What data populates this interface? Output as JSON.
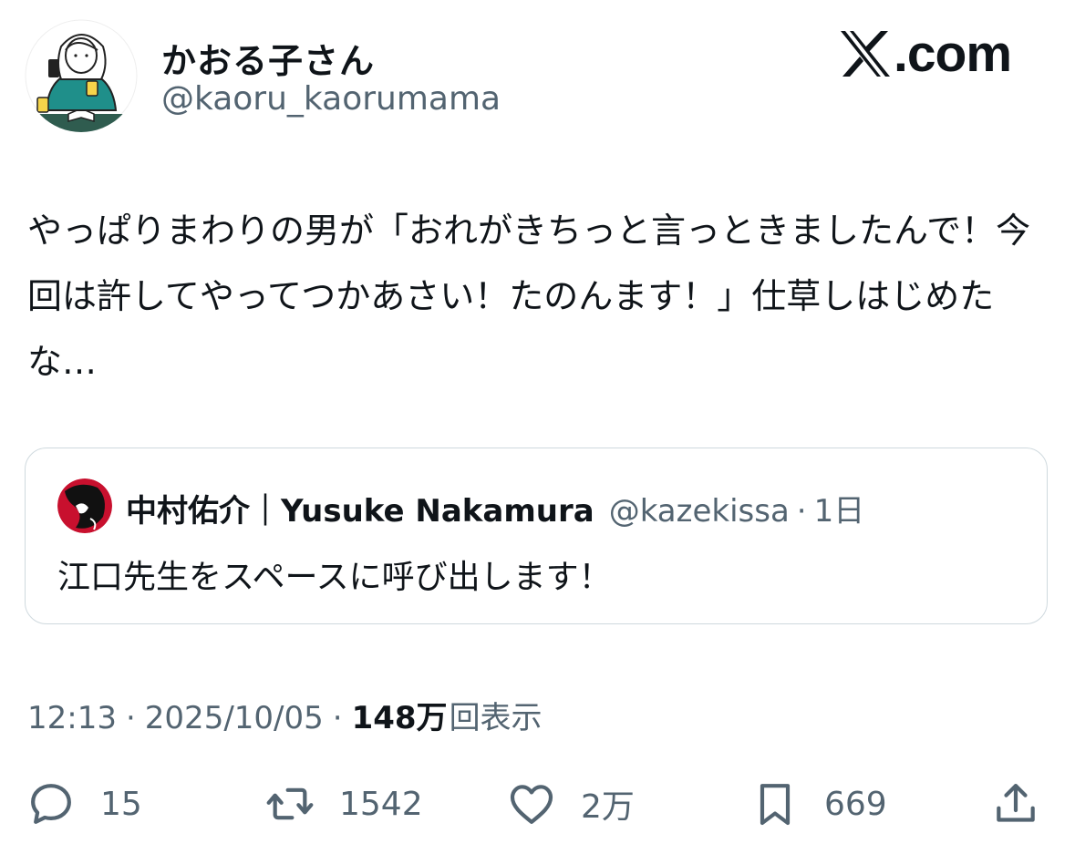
{
  "author": {
    "display_name": "かおる子さん",
    "handle": "@kaoru_kaorumama",
    "avatar": "illustrated-woman-with-phone-avatar"
  },
  "brand": {
    "label": ".com",
    "icon": "x-logo-icon"
  },
  "tweet": {
    "text": "やっぱりまわりの男が「おれがきちっと言っときましたんで！今回は許してやってつかあさい！たのんます！」仕草しはじめたな…"
  },
  "quote": {
    "display_name": "中村佑介｜Yusuke Nakamura",
    "handle": "@kazekissa",
    "separator": "·",
    "time": "1日",
    "text": "江口先生をスペースに呼び出します！",
    "avatar": "red-black-illustration-avatar"
  },
  "meta": {
    "time": "12:13",
    "separator": "·",
    "date": "2025/10/05",
    "views_count": "148万",
    "views_label": "回表示"
  },
  "actions": {
    "reply_count": "15",
    "retweet_count": "1542",
    "like_count": "2万",
    "bookmark_count": "669"
  },
  "colors": {
    "text": "#0f1419",
    "secondary": "#536471",
    "border": "#cfd9de",
    "avatar_teal": "#1f8f8a"
  }
}
